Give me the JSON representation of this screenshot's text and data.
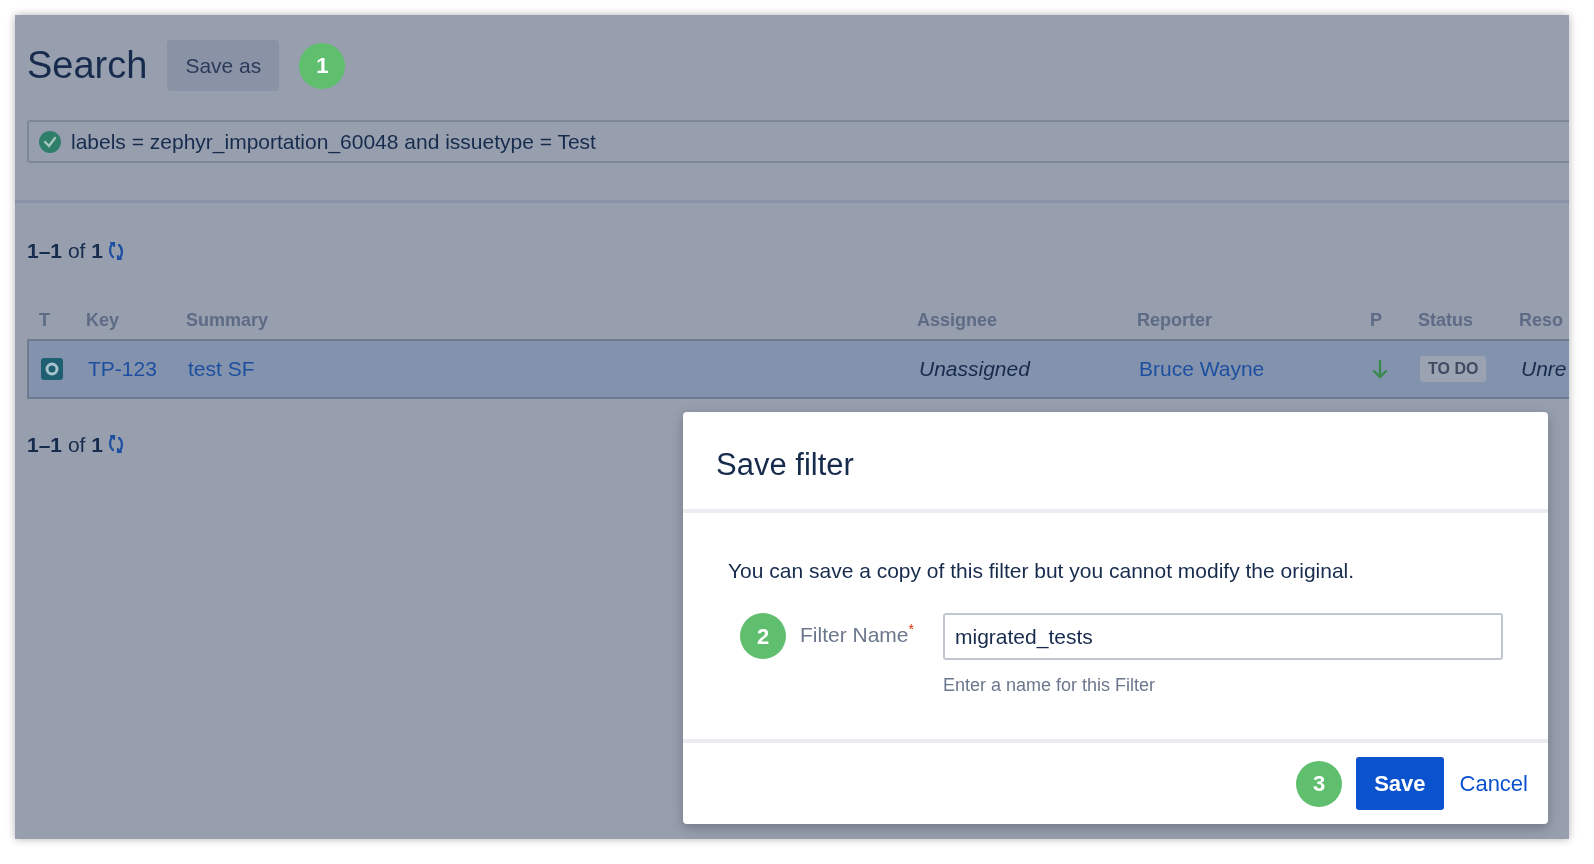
{
  "header": {
    "title": "Search",
    "save_as_button": "Save as",
    "step_badge": "1"
  },
  "query": {
    "valid": true,
    "text": "labels = zephyr_importation_60048 and issuetype = Test"
  },
  "results_count_top": "**1–1** of **1**",
  "table": {
    "columns": [
      "T",
      "Key",
      "Summary",
      "Assignee",
      "Reporter",
      "P",
      "Status",
      "Reso"
    ],
    "rows": [
      {
        "selected": true,
        "key": "TP-123",
        "summary": "test SF",
        "assignee": "Unassigned",
        "reporter": "Bruce Wayne",
        "status": "TO DO",
        "resolution": "Unre"
      }
    ]
  },
  "results_count_bottom": "**1–1** of **1**",
  "dialog": {
    "title": "Save filter",
    "message": "You can save a copy of this filter but you cannot modify the original.",
    "step_badge_name": "2",
    "field_label": "Filter Name",
    "required_mark": "*",
    "field_value": "migrated_tests",
    "field_hint": "Enter a name for this Filter",
    "step_badge_save": "3",
    "save_button": "Save",
    "cancel_link": "Cancel"
  }
}
